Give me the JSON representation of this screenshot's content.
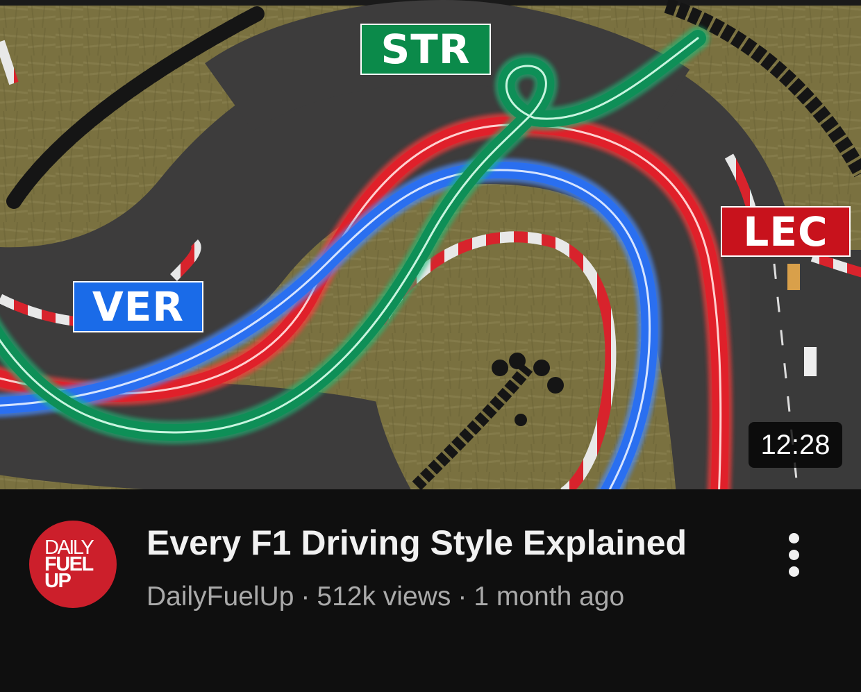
{
  "thumbnail": {
    "labels": {
      "str": {
        "text": "STR",
        "color": "#0b8a4a"
      },
      "lec": {
        "text": "LEC",
        "color": "#c8121c"
      },
      "ver": {
        "text": "VER",
        "color": "#1a6be8"
      }
    },
    "duration": "12:28",
    "line_colors": {
      "str": "#0e8f57",
      "lec": "#e0202a",
      "ver": "#2a6ff0"
    }
  },
  "video": {
    "title": "Every F1 Driving Style Explained",
    "channel": "DailyFuelUp",
    "views": "512k views",
    "age": "1 month ago",
    "separator": "·"
  },
  "channel_avatar": {
    "line1": "DAILY",
    "line2": "FUEL",
    "line3": "UP",
    "color": "#cc1f2b"
  },
  "icons": {
    "menu": "more-vertical-icon"
  }
}
